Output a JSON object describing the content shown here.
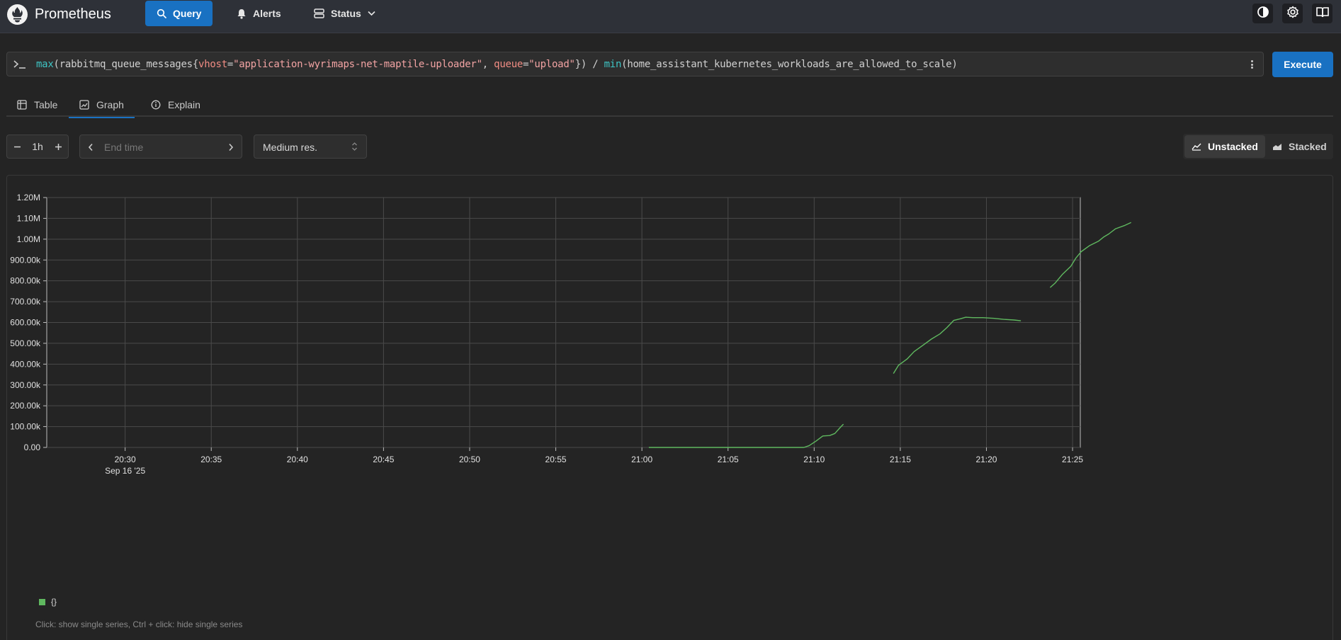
{
  "app": {
    "title": "Prometheus",
    "nav": [
      {
        "label": "Query",
        "icon": "search-icon",
        "active": true
      },
      {
        "label": "Alerts",
        "icon": "bell-icon",
        "active": false
      },
      {
        "label": "Status",
        "icon": "server-icon",
        "active": false
      }
    ],
    "right_icons": [
      "contrast-icon",
      "gear-icon",
      "book-icon"
    ]
  },
  "query": {
    "expression": "max(rabbitmq_queue_messages{vhost=\"application-wyrimaps-net-maptile-uploader\", queue=\"upload\"}) / min(home_assistant_kubernetes_workloads_are_allowed_to_scale)",
    "tokens": [
      {
        "t": "max",
        "c": "fn"
      },
      {
        "t": "(rabbitmq_queue_messages{",
        "c": "plain"
      },
      {
        "t": "vhost",
        "c": "label"
      },
      {
        "t": "=",
        "c": "plain"
      },
      {
        "t": "\"application-wyrimaps-net-maptile-uploader\"",
        "c": "str"
      },
      {
        "t": ", ",
        "c": "plain"
      },
      {
        "t": "queue",
        "c": "label"
      },
      {
        "t": "=",
        "c": "plain"
      },
      {
        "t": "\"upload\"",
        "c": "str"
      },
      {
        "t": "}) / ",
        "c": "plain"
      },
      {
        "t": "min",
        "c": "fn"
      },
      {
        "t": "(home_assistant_kubernetes_workloads_are_allowed_to_scale)",
        "c": "plain"
      }
    ],
    "execute_label": "Execute"
  },
  "tabs": [
    {
      "label": "Table",
      "icon": "table-icon",
      "active": false
    },
    {
      "label": "Graph",
      "icon": "graph-icon",
      "active": true
    },
    {
      "label": "Explain",
      "icon": "info-icon",
      "active": false
    }
  ],
  "controls": {
    "range_value": "1h",
    "end_time_placeholder": "End time",
    "resolution": "Medium res.",
    "stack_modes": [
      {
        "label": "Unstacked",
        "active": true
      },
      {
        "label": "Stacked",
        "active": false
      }
    ]
  },
  "chart_data": {
    "type": "line",
    "x_date_label": "Sep 16 '25",
    "x_ticks": [
      "20:30",
      "20:35",
      "20:40",
      "20:45",
      "20:50",
      "20:55",
      "21:00",
      "21:05",
      "21:10",
      "21:15",
      "21:20",
      "21:25"
    ],
    "y_ticks": [
      "0.00",
      "100.00k",
      "200.00k",
      "300.00k",
      "400.00k",
      "500.00k",
      "600.00k",
      "700.00k",
      "800.00k",
      "900.00k",
      "1.00M",
      "1.10M",
      "1.20M"
    ],
    "xlim_minutes_from_2030": [
      -4.55,
      55.45
    ],
    "ylim": [
      0,
      1200000
    ],
    "grid": true,
    "series": [
      {
        "name": "{}",
        "color": "#5fb85f",
        "segments": [
          [
            [
              30.4,
              0
            ],
            [
              32,
              0
            ],
            [
              34,
              0
            ],
            [
              36,
              0
            ],
            [
              38,
              0
            ],
            [
              39.1,
              0
            ],
            [
              39.4,
              0
            ],
            [
              39.7,
              8000
            ],
            [
              40.1,
              30000
            ],
            [
              40.5,
              55000
            ],
            [
              40.9,
              57000
            ],
            [
              41.2,
              67000
            ],
            [
              41.5,
              95000
            ],
            [
              41.7,
              112000
            ]
          ],
          [
            [
              44.6,
              355000
            ],
            [
              44.9,
              395000
            ],
            [
              45.4,
              425000
            ],
            [
              45.8,
              460000
            ],
            [
              46.3,
              490000
            ],
            [
              46.8,
              520000
            ],
            [
              47.3,
              545000
            ],
            [
              47.7,
              575000
            ],
            [
              48.1,
              610000
            ],
            [
              48.5,
              618000
            ],
            [
              48.8,
              625000
            ],
            [
              49.2,
              623000
            ],
            [
              49.8,
              623000
            ],
            [
              50.4,
              620000
            ],
            [
              51.0,
              615000
            ],
            [
              51.6,
              612000
            ],
            [
              52.0,
              608000
            ]
          ],
          [
            [
              53.7,
              768000
            ],
            [
              54.0,
              790000
            ],
            [
              54.4,
              830000
            ],
            [
              54.9,
              870000
            ],
            [
              55.2,
              910000
            ],
            [
              55.5,
              940000
            ],
            [
              56.0,
              970000
            ],
            [
              56.5,
              990000
            ],
            [
              56.8,
              1010000
            ],
            [
              57.1,
              1025000
            ],
            [
              57.5,
              1050000
            ],
            [
              58.0,
              1065000
            ],
            [
              58.4,
              1080000
            ]
          ]
        ]
      }
    ],
    "legend_hint": "Click: show single series, Ctrl + click: hide single series"
  }
}
